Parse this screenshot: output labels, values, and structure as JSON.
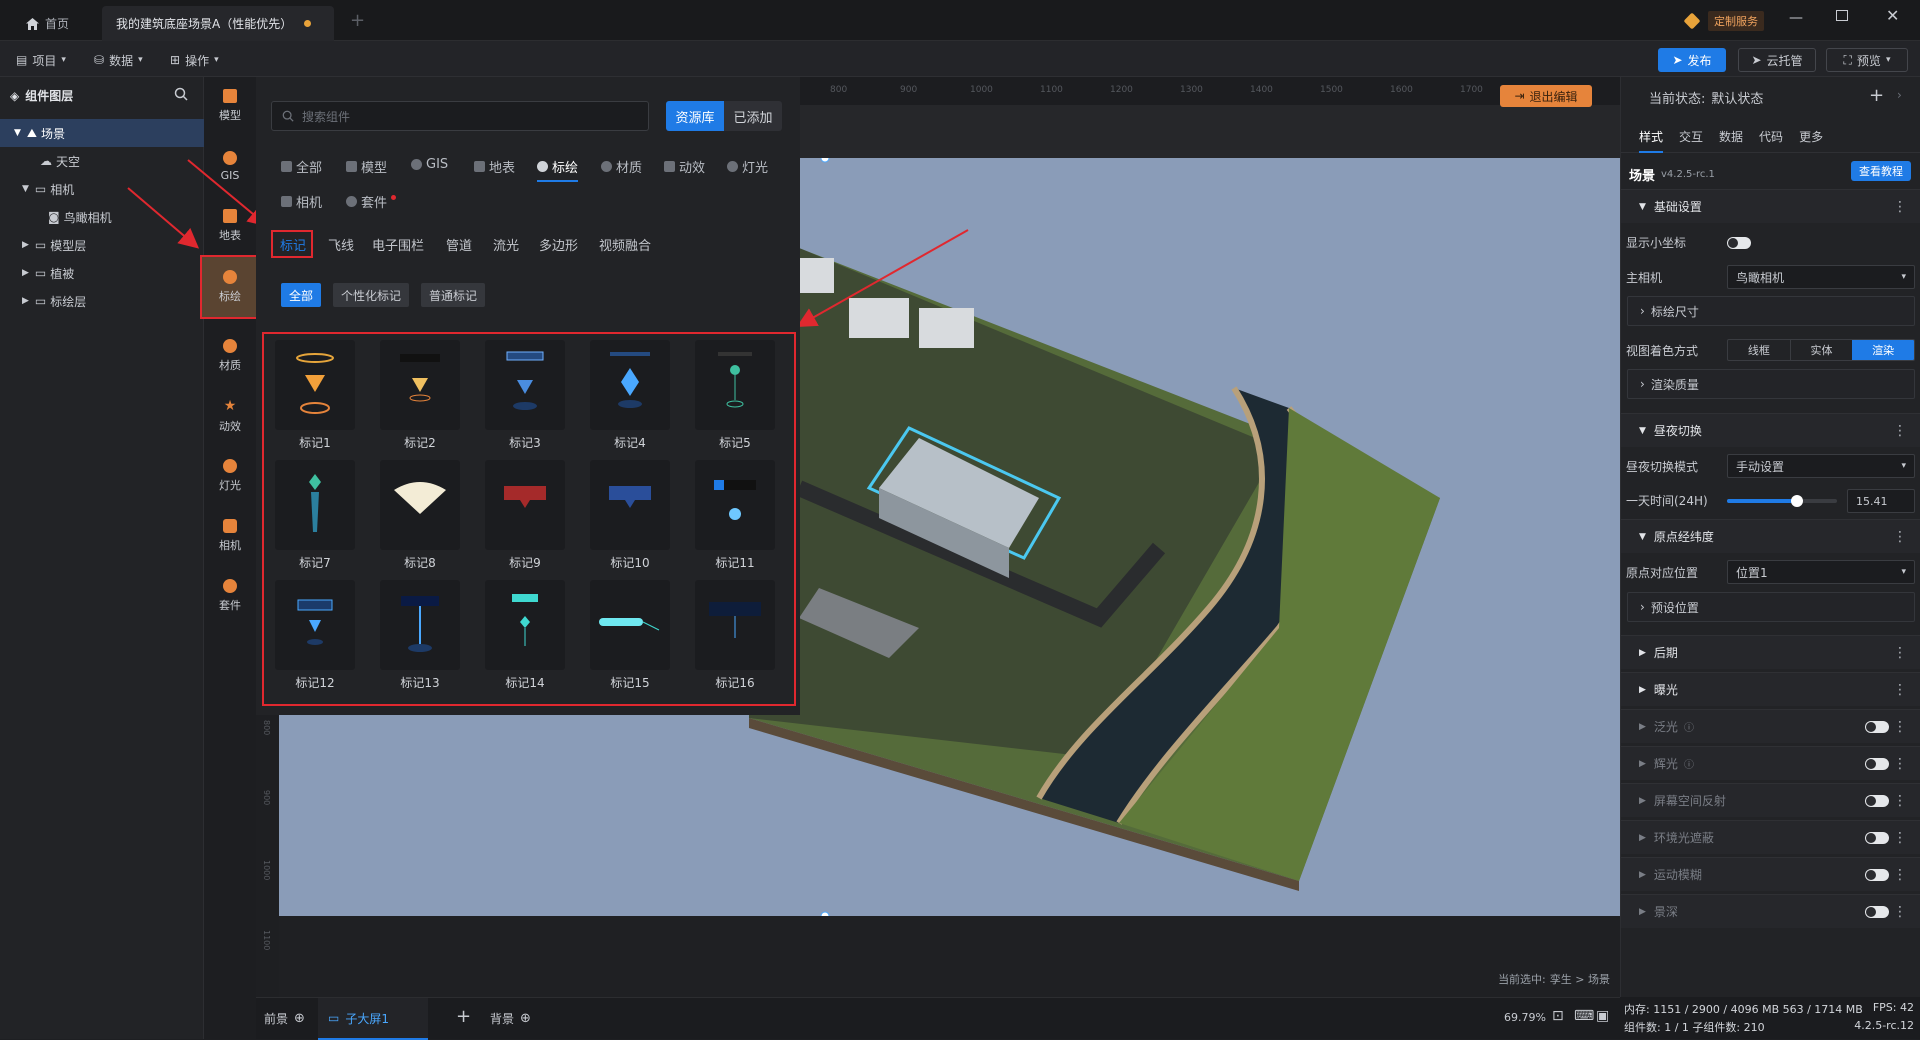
{
  "titlebar": {
    "home_tab": "首页",
    "doc_tab": "我的建筑底座场景A（性能优先）",
    "custom_service": "定制服务"
  },
  "toolbar": {
    "project": "项目",
    "data": "数据",
    "operate": "操作",
    "publish": "发布",
    "cloud_host": "云托管",
    "preview": "预览"
  },
  "layers": {
    "title": "组件图层",
    "items": [
      "场景",
      "天空",
      "相机",
      "鸟瞰相机",
      "模型层",
      "植被",
      "标绘层"
    ]
  },
  "rail": [
    "模型",
    "GIS",
    "地表",
    "标绘",
    "材质",
    "动效",
    "灯光",
    "相机",
    "套件"
  ],
  "panel": {
    "search_placeholder": "搜索组件",
    "tab_library": "资源库",
    "tab_added": "已添加",
    "categories": [
      "全部",
      "模型",
      "GIS",
      "地表",
      "标绘",
      "材质",
      "动效",
      "灯光",
      "相机",
      "套件"
    ],
    "subtabs": [
      "标记",
      "飞线",
      "电子围栏",
      "管道",
      "流光",
      "多边形",
      "视频融合"
    ],
    "chips": [
      "全部",
      "个性化标记",
      "普通标记"
    ],
    "cards": [
      "标记1",
      "标记2",
      "标记3",
      "标记4",
      "标记5",
      "标记7",
      "标记8",
      "标记9",
      "标记10",
      "标记11",
      "标记12",
      "标记13",
      "标记14",
      "标记15",
      "标记16"
    ]
  },
  "canvas": {
    "exit_edit": "退出编辑",
    "ruler_top": [
      "800",
      "900",
      "1000",
      "1100",
      "1200",
      "1300",
      "1400",
      "1500",
      "1600",
      "1700"
    ],
    "ruler_left": [
      "800",
      "900",
      "1000",
      "1100"
    ],
    "selection_prefix": "当前选中:",
    "selection_path": "孪生 > 场景"
  },
  "right": {
    "state_label": "当前状态:",
    "state_value": "默认状态",
    "tabs": [
      "样式",
      "交互",
      "数据",
      "代码",
      "更多"
    ],
    "scene_title": "场景",
    "version": "v4.2.5-rc.1",
    "tutorial": "查看教程",
    "basic": "基础设置",
    "show_axis": "显示小坐标",
    "main_camera": "主相机",
    "main_camera_value": "鸟瞰相机",
    "plot_size": "标绘尺寸",
    "shading": "视图着色方式",
    "shading_options": [
      "线框",
      "实体",
      "渲染"
    ],
    "render_quality": "渲染质量",
    "daynight": "昼夜切换",
    "daynight_mode": "昼夜切换模式",
    "daynight_mode_value": "手动设置",
    "day_time": "一天时间(24H)",
    "day_time_value": "15.41",
    "day_time_level": 0.64,
    "origin": "原点经纬度",
    "origin_pos": "原点对应位置",
    "origin_pos_value": "位置1",
    "preset_pos": "预设位置",
    "post": "后期",
    "exposure": "曝光",
    "effects": [
      "泛光",
      "辉光",
      "屏幕空间反射",
      "环境光遮蔽",
      "运动模糊",
      "景深"
    ]
  },
  "bottom": {
    "front": "前景",
    "child": "子大屏1",
    "back": "背景",
    "zoom": "69.79%"
  },
  "status": {
    "memory": "内存: 1151 / 2900 / 4096 MB  563 / 1714 MB",
    "fps": "FPS: 42",
    "components": "组件数: 1 / 1   子组件数: 210",
    "version": "4.2.5-rc.12"
  },
  "colors": {
    "accent": "#1f7be6",
    "highlight_red": "#e0282f",
    "orange": "#e6843b"
  }
}
